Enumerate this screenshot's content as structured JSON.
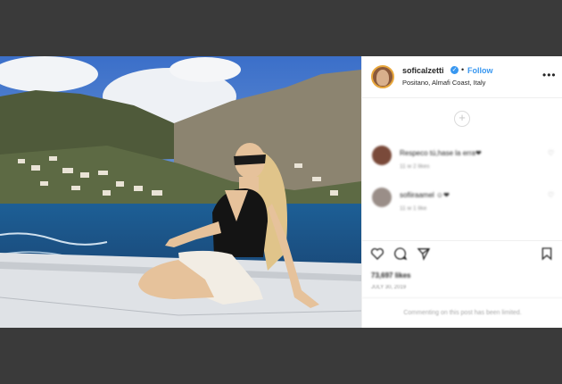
{
  "post": {
    "username": "soficalzetti",
    "follow_label": "Follow",
    "location": "Positano, Almafi Coast, Italy",
    "more_icon": "•••",
    "load_more_icon": "+",
    "comments": [
      {
        "text": "Respeco tú,hase la erra❤",
        "meta": "11 w   2 likes",
        "avatar_color": "#7a4a3a"
      },
      {
        "text": "sofiiraamel ☺❤",
        "meta": "11 w   1 like",
        "avatar_color": "#9a8e88"
      }
    ],
    "likes": "73,697 likes",
    "date": "JULY 30, 2019",
    "comments_disabled": "Commenting on this post has been limited.",
    "verified_icon": "✓",
    "colors": {
      "accent": "#3897f0",
      "background": "#3a3a3a"
    }
  }
}
